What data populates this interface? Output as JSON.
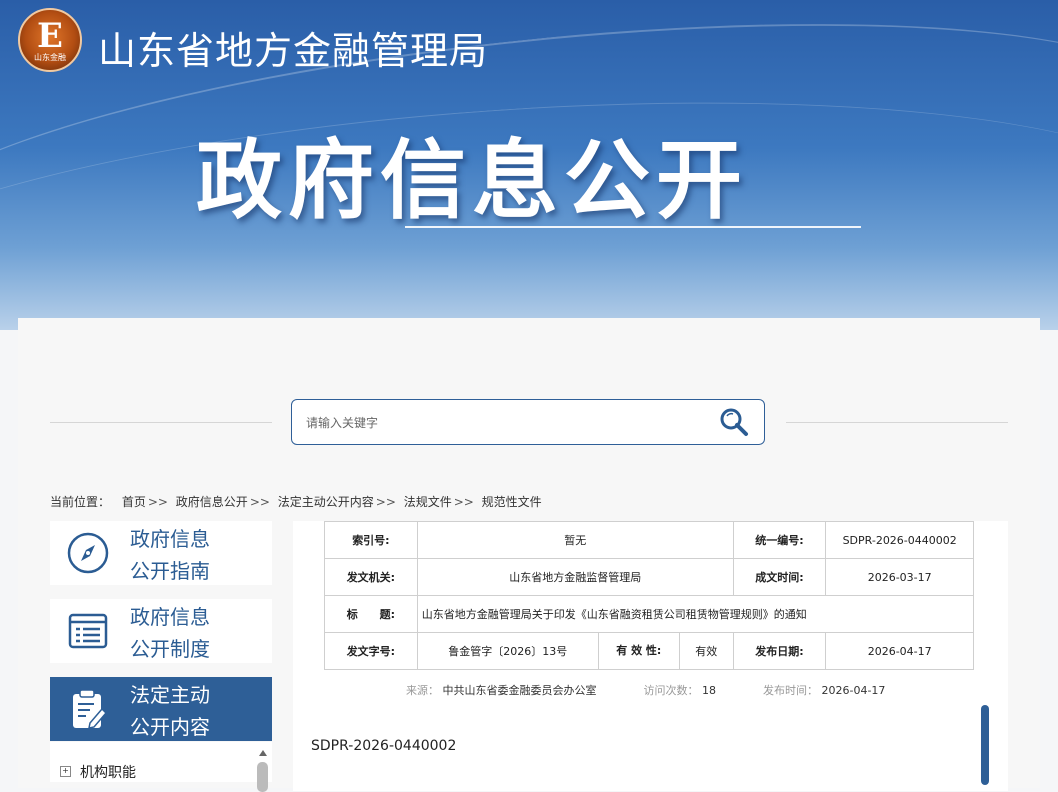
{
  "header": {
    "logo_text": "E",
    "logo_subtext": "山东金融",
    "site_title": "山东省地方金融管理局",
    "hero_title": "政府信息公开"
  },
  "search": {
    "placeholder": "请输入关键字"
  },
  "breadcrumb": {
    "prefix": "当前位置：",
    "items": [
      "首页",
      "政府信息公开",
      "法定主动公开内容",
      "法规文件",
      "规范性文件"
    ],
    "separator": ">>"
  },
  "sidebar": {
    "items": [
      {
        "line1": "政府信息",
        "line2": "公开指南",
        "icon": "compass-icon",
        "active": false
      },
      {
        "line1": "政府信息",
        "line2": "公开制度",
        "icon": "document-list-icon",
        "active": false
      },
      {
        "line1": "法定主动",
        "line2": "公开内容",
        "icon": "clipboard-edit-icon",
        "active": true
      }
    ],
    "tree": [
      {
        "label": "机构职能"
      }
    ]
  },
  "meta": {
    "index_label": "索引号:",
    "index_value": "暂无",
    "code_label": "统一编号:",
    "code_value": "SDPR-2026-0440002",
    "issuer_label": "发文机关:",
    "issuer_value": "山东省地方金融监督管理局",
    "created_label": "成文时间:",
    "created_value": "2026-03-17",
    "title_label": "标　　题:",
    "title_value": "山东省地方金融管理局关于印发《山东省融资租赁公司租赁物管理规则》的通知",
    "docno_label": "发文字号:",
    "docno_value": "鲁金管字〔2026〕13号",
    "valid_label": "有 效 性:",
    "valid_value": "有效",
    "publish_label": "发布日期:",
    "publish_value": "2026-04-17"
  },
  "stats": {
    "source_label": "来源：",
    "source_value": "中共山东省委金融委员会办公室",
    "visits_label": "访问次数：",
    "visits_value": "18",
    "time_label": "发布时间：",
    "time_value": "2026-04-17"
  },
  "body": {
    "doc_number": "SDPR-2026-0440002"
  },
  "colors": {
    "primary": "#2e5f97",
    "banner": "#3d79c0"
  }
}
